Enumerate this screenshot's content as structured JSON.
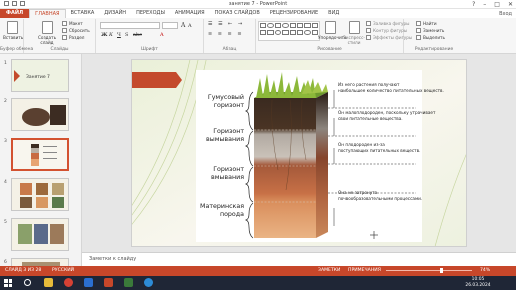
{
  "window": {
    "title": "занятие 7 - PowerPoint",
    "controls": [
      "?",
      "–",
      "□",
      "✕"
    ]
  },
  "tabs": [
    "ФАЙЛ",
    "ГЛАВНАЯ",
    "ВСТАВКА",
    "ДИЗАЙН",
    "ПЕРЕХОДЫ",
    "АНИМАЦИЯ",
    "ПОКАЗ СЛАЙДОВ",
    "РЕЦЕНЗИРОВАНИЕ",
    "ВИД"
  ],
  "signin": "Вход",
  "ribbon": {
    "clipboard": {
      "paste": "Вставить",
      "label": "Буфер обмена"
    },
    "slides": {
      "create": "Создать слайд",
      "layout": "Макет",
      "reset": "Сбросить",
      "section": "Раздел",
      "label": "Слайды"
    },
    "font": {
      "name": "",
      "size": "",
      "label": "Шрифт"
    },
    "paragraph": {
      "label": "Абзац"
    },
    "drawing": {
      "arrange": "Упорядочить",
      "quick_styles": "Экспресс-стили",
      "fill": "Заливка фигуры",
      "outline": "Контур фигуры",
      "effects": "Эффекты фигуры",
      "label": "Рисование"
    },
    "editing": {
      "find": "Найти",
      "replace": "Заменить",
      "select": "Выделить",
      "label": "Редактирование"
    }
  },
  "thumbnails": [
    {
      "num": "1",
      "caption": "Занятие 7"
    },
    {
      "num": "2"
    },
    {
      "num": "3"
    },
    {
      "num": "4"
    },
    {
      "num": "5"
    },
    {
      "num": "6"
    }
  ],
  "slide": {
    "horizons": [
      "Гумусовый горизонт",
      "Горизонт вымывания",
      "Горизонт вмывания",
      "Материнская порода"
    ],
    "notes": [
      "Из него растения получают наибольшее количество питательных веществ.",
      "Он малоплодороден, поскольку утрачивает свои питательные вещества.",
      "Он плодороден из-за поступающих питательных веществ.",
      "Она не затронута почвообразовательными процессами."
    ]
  },
  "notes_placeholder": "Заметки к слайду",
  "status": {
    "slide": "СЛАЙД 3 ИЗ 28",
    "language": "РУССКИЙ",
    "notes": "ЗАМЕТКИ",
    "comments": "ПРИМЕЧАНИЯ",
    "zoom": "74%"
  },
  "taskbar": {
    "time": "10:05",
    "date": "26.03.2024"
  },
  "colors": {
    "accent": "#c7472a",
    "taskbar": "#1f2636",
    "slide_arrow": "#c44a2c"
  }
}
